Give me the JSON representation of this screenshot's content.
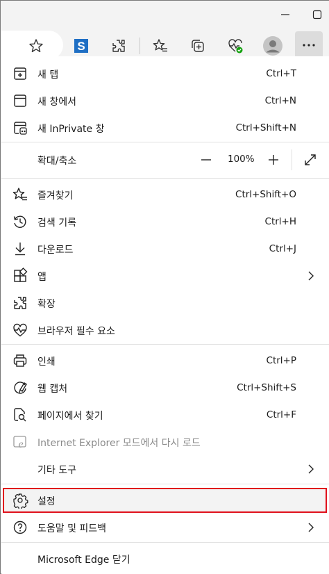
{
  "toolbar": {
    "icons": [
      "favorite-star-icon",
      "s-extension-icon",
      "extensions-icon",
      "favorites-icon",
      "collections-icon",
      "browser-essentials-icon",
      "profile-avatar-icon",
      "more-icon"
    ]
  },
  "menu": {
    "new_tab": {
      "label": "새 탭",
      "shortcut": "Ctrl+T"
    },
    "new_window": {
      "label": "새 창에서",
      "shortcut": "Ctrl+N"
    },
    "new_inprivate": {
      "label": "새 InPrivate 창",
      "shortcut": "Ctrl+Shift+N"
    },
    "zoom": {
      "label": "확대/축소",
      "minus": "—",
      "value": "100%",
      "plus": "+"
    },
    "favorites": {
      "label": "즐겨찾기",
      "shortcut": "Ctrl+Shift+O"
    },
    "history": {
      "label": "검색 기록",
      "shortcut": "Ctrl+H"
    },
    "downloads": {
      "label": "다운로드",
      "shortcut": "Ctrl+J"
    },
    "apps": {
      "label": "앱"
    },
    "extensions": {
      "label": "확장"
    },
    "essentials": {
      "label": "브라우저 필수 요소"
    },
    "print": {
      "label": "인쇄",
      "shortcut": "Ctrl+P"
    },
    "web_capture": {
      "label": "웹 캡처",
      "shortcut": "Ctrl+Shift+S"
    },
    "find": {
      "label": "페이지에서 찾기",
      "shortcut": "Ctrl+F"
    },
    "ie_mode": {
      "label": "Internet Explorer 모드에서 다시 로드"
    },
    "more_tools": {
      "label": "기타 도구"
    },
    "settings": {
      "label": "설정"
    },
    "help": {
      "label": "도움말 및 피드백"
    },
    "close": {
      "label": "Microsoft Edge 닫기"
    }
  },
  "colors": {
    "highlight_border": "#e0101b",
    "menu_bg": "#ffffff",
    "chrome_bg": "#f3f3f3"
  }
}
